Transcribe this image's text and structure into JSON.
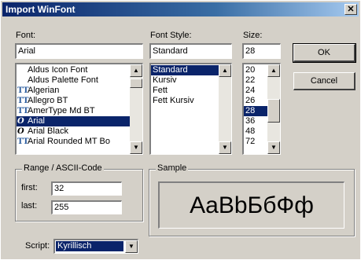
{
  "window": {
    "title": "Import WinFont"
  },
  "font": {
    "label": "Font:",
    "value": "Arial",
    "items": [
      {
        "name": "Aldus Icon Font",
        "icon": ""
      },
      {
        "name": "Aldus Palette Font",
        "icon": ""
      },
      {
        "name": "Algerian",
        "icon": "TT"
      },
      {
        "name": "Allegro BT",
        "icon": "TT"
      },
      {
        "name": "AmerType Md BT",
        "icon": "TT"
      },
      {
        "name": "Arial",
        "icon": "O",
        "selected": true
      },
      {
        "name": "Arial Black",
        "icon": "O"
      },
      {
        "name": "Arial Rounded MT Bo",
        "icon": "TT"
      }
    ]
  },
  "style": {
    "label": "Font Style:",
    "value": "Standard",
    "items": [
      {
        "name": "Standard",
        "selected": true
      },
      {
        "name": "Kursiv"
      },
      {
        "name": "Fett"
      },
      {
        "name": "Fett Kursiv"
      }
    ]
  },
  "size": {
    "label": "Size:",
    "value": "28",
    "items": [
      {
        "name": "20"
      },
      {
        "name": "22"
      },
      {
        "name": "24"
      },
      {
        "name": "26"
      },
      {
        "name": "28",
        "selected": true
      },
      {
        "name": "36"
      },
      {
        "name": "48"
      },
      {
        "name": "72"
      }
    ]
  },
  "buttons": {
    "ok": "OK",
    "cancel": "Cancel"
  },
  "range": {
    "label": "Range / ASCII-Code",
    "first_label": "first:",
    "first_value": "32",
    "last_label": "last:",
    "last_value": "255"
  },
  "sample": {
    "label": "Sample",
    "text": "AaBbБбФф"
  },
  "script": {
    "label": "Script:",
    "value": "Kyrillisch"
  },
  "colors": {
    "title_start": "#0a246a",
    "selection": "#0a246a",
    "face": "#d4d0c8"
  }
}
